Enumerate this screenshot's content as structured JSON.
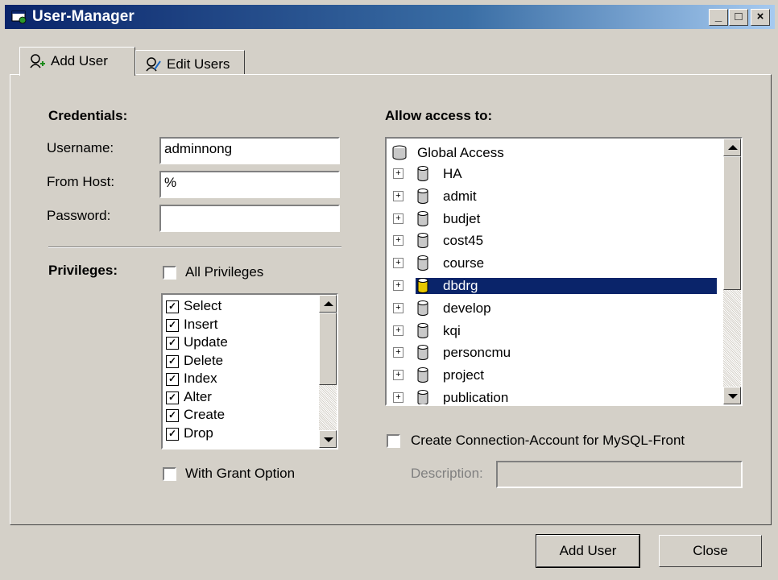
{
  "window": {
    "title": "User-Manager",
    "controls": {
      "minimize": "_",
      "maximize": "□",
      "close": "×"
    }
  },
  "tabs": [
    {
      "label": "Add User",
      "icon": "add-user-icon",
      "active": true
    },
    {
      "label": "Edit Users",
      "icon": "edit-users-icon",
      "active": false
    }
  ],
  "credentials": {
    "heading": "Credentials:",
    "username_label": "Username:",
    "username_value": "adminnong",
    "host_label": "From Host:",
    "host_value": "%",
    "password_label": "Password:",
    "password_value": ""
  },
  "privileges": {
    "heading": "Privileges:",
    "all_label": "All Privileges",
    "all_checked": false,
    "items": [
      {
        "label": "Select",
        "checked": true
      },
      {
        "label": "Insert",
        "checked": true
      },
      {
        "label": "Update",
        "checked": true
      },
      {
        "label": "Delete",
        "checked": true
      },
      {
        "label": "Index",
        "checked": true
      },
      {
        "label": "Alter",
        "checked": true
      },
      {
        "label": "Create",
        "checked": true
      },
      {
        "label": "Drop",
        "checked": true
      }
    ],
    "grant_label": "With Grant Option",
    "grant_checked": false
  },
  "access": {
    "heading": "Allow access to:",
    "root": "Global Access",
    "databases": [
      "HA",
      "admit",
      "budjet",
      "cost45",
      "course",
      "dbdrg",
      "develop",
      "kqi",
      "personcmu",
      "project",
      "publication"
    ],
    "selected": "dbdrg"
  },
  "connection": {
    "create_label": "Create Connection-Account for MySQL-Front",
    "create_checked": false,
    "description_label": "Description:",
    "description_value": ""
  },
  "buttons": {
    "add_user": "Add User",
    "close": "Close"
  },
  "colors": {
    "titlebar": "#0a246a",
    "selection": "#0a246a",
    "face": "#d4d0c8"
  }
}
